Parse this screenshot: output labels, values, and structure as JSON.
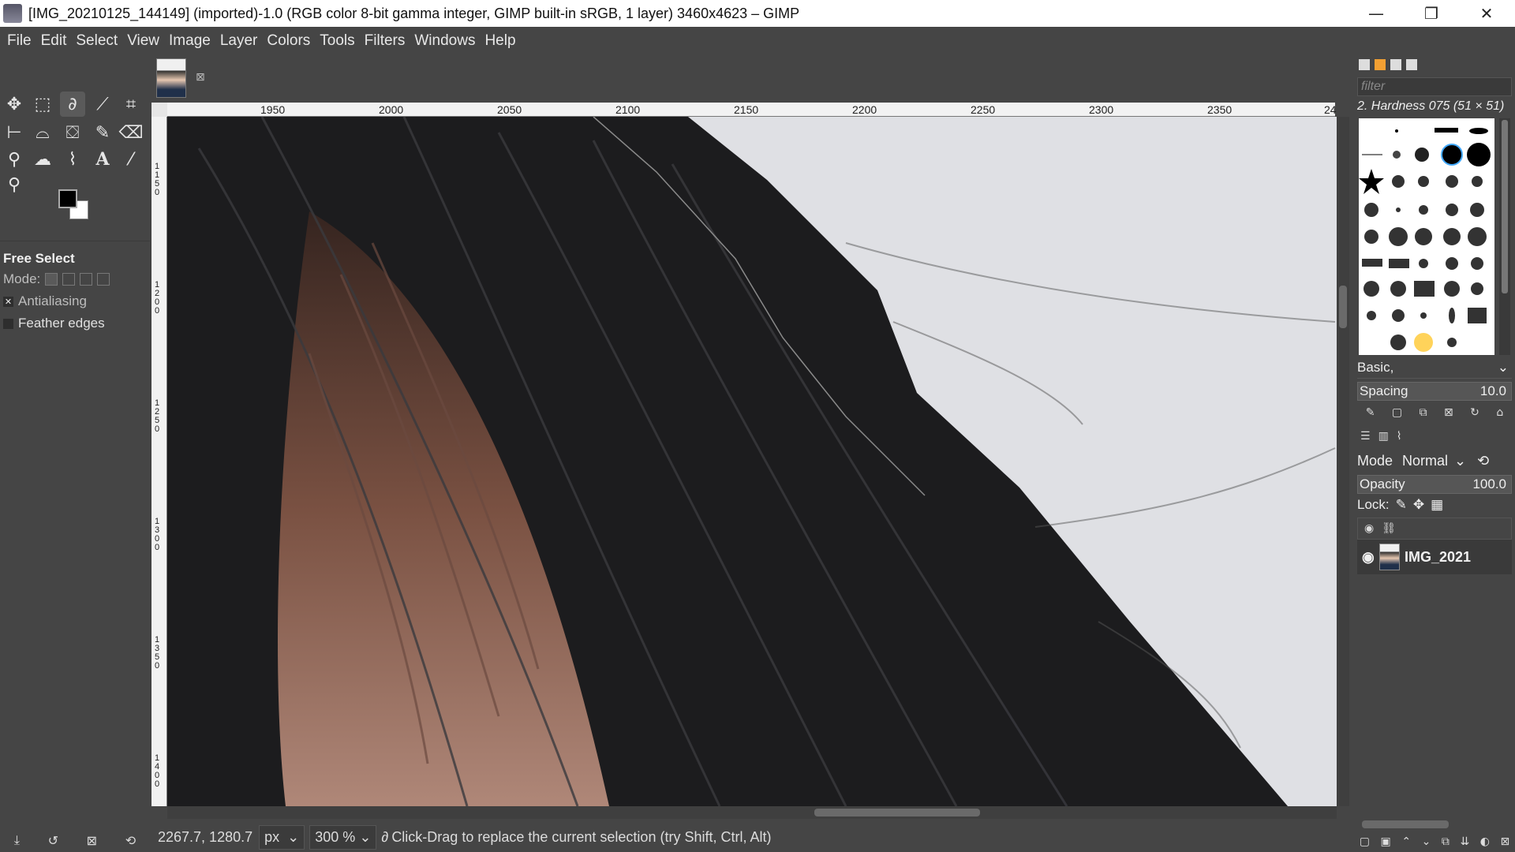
{
  "window": {
    "title": "[IMG_20210125_144149] (imported)-1.0 (RGB color 8-bit gamma integer, GIMP built-in sRGB, 1 layer) 3460x4623 – GIMP",
    "minimize": "—",
    "maximize": "❐",
    "close": "✕"
  },
  "menu": [
    "File",
    "Edit",
    "Select",
    "View",
    "Image",
    "Layer",
    "Colors",
    "Tools",
    "Filters",
    "Windows",
    "Help"
  ],
  "toolbox": {
    "tools": [
      {
        "name": "move-tool-icon",
        "glyph": "✥"
      },
      {
        "name": "rect-select-tool-icon",
        "glyph": "⬚"
      },
      {
        "name": "free-select-tool-icon",
        "glyph": "∂",
        "active": true
      },
      {
        "name": "fuzzy-select-tool-icon",
        "glyph": "⟋"
      },
      {
        "name": "crop-tool-icon",
        "glyph": "⌗"
      },
      {
        "name": "unified-transform-tool-icon",
        "glyph": "⊢"
      },
      {
        "name": "warp-transform-tool-icon",
        "glyph": "⌓"
      },
      {
        "name": "bucket-fill-tool-icon",
        "glyph": "⛋"
      },
      {
        "name": "paintbrush-tool-icon",
        "glyph": "✎"
      },
      {
        "name": "eraser-tool-icon",
        "glyph": "⌫"
      },
      {
        "name": "clone-tool-icon",
        "glyph": "⚲"
      },
      {
        "name": "smudge-tool-icon",
        "glyph": "☁"
      },
      {
        "name": "paths-tool-icon",
        "glyph": "⌇"
      },
      {
        "name": "text-tool-icon",
        "glyph": "A"
      },
      {
        "name": "color-picker-tool-icon",
        "glyph": "⁄"
      },
      {
        "name": "zoom-tool-icon",
        "glyph": "⚲"
      }
    ],
    "fg_color": "#000000",
    "bg_color": "#ffffff"
  },
  "tool_options": {
    "title": "Free Select",
    "mode_label": "Mode:",
    "antialiasing": {
      "label": "Antialiasing",
      "checked": true
    },
    "feather": {
      "label": "Feather edges",
      "checked": false
    }
  },
  "ruler": {
    "h_labels": [
      "1950",
      "2000",
      "2050",
      "2100",
      "2150",
      "2200",
      "2250",
      "2300",
      "2350",
      "24"
    ],
    "v_labels": [
      "1150",
      "1200",
      "1250",
      "1300",
      "1350",
      "1400"
    ]
  },
  "status": {
    "coords": "2267.7, 1280.7",
    "unit": "px",
    "zoom": "300 %",
    "message": "Click-Drag to replace the current selection (try Shift, Ctrl, Alt)"
  },
  "brushes": {
    "filter_placeholder": "filter",
    "selected": "2. Hardness 075 (51 × 51)",
    "preset": "Basic,",
    "spacing_label": "Spacing",
    "spacing_value": "10.0"
  },
  "layers": {
    "mode_label": "Mode",
    "mode_value": "Normal",
    "opacity_label": "Opacity",
    "opacity_value": "100.0",
    "lock_label": "Lock:",
    "layer_name": "IMG_2021"
  }
}
